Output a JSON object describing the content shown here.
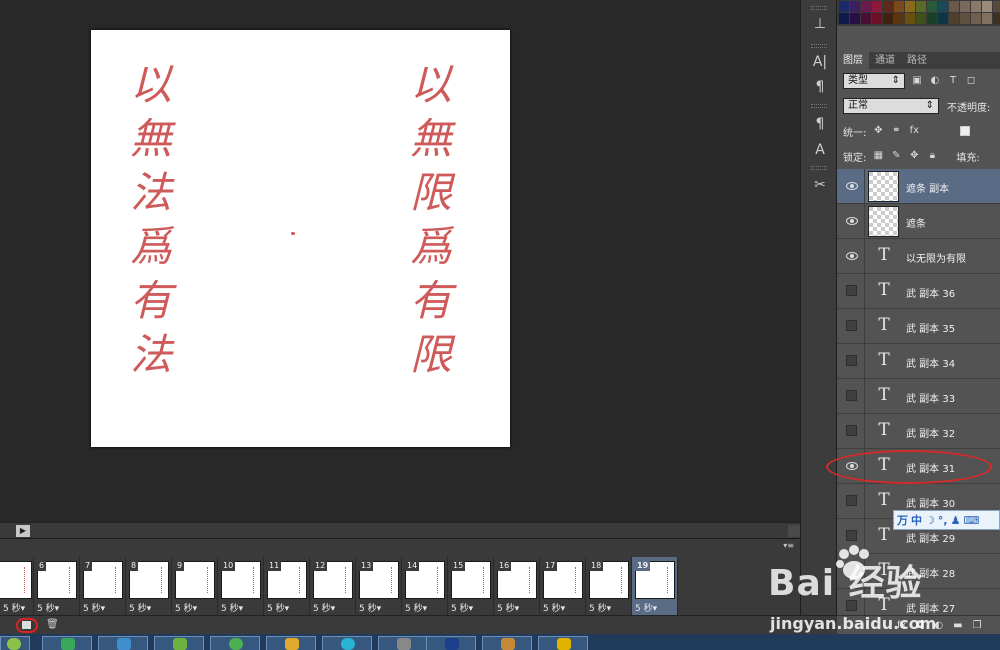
{
  "canvas": {
    "left_column": [
      "以",
      "無",
      "法",
      "爲",
      "有",
      "法"
    ],
    "right_column": [
      "以",
      "無",
      "限",
      "爲",
      "有",
      "限"
    ],
    "ink_color": "#cf5a5a"
  },
  "panels": {
    "tabs": [
      {
        "label": "图层",
        "active": true
      },
      {
        "label": "通道",
        "active": false
      },
      {
        "label": "路径",
        "active": false
      }
    ],
    "filter_kind": "类型",
    "blend_mode": "正常",
    "opacity_label": "不透明度:",
    "unify_label": "统一:",
    "lock_label": "锁定:",
    "fill_label": "填充:"
  },
  "layers": [
    {
      "name": "遮条 副本",
      "type": "image",
      "visible": true,
      "selected": true
    },
    {
      "name": "遮条",
      "type": "image",
      "visible": true,
      "selected": false
    },
    {
      "name": "以无限为有限",
      "type": "text",
      "visible": true,
      "selected": false
    },
    {
      "name": "武 副本 36",
      "type": "text",
      "visible": false,
      "selected": false
    },
    {
      "name": "武 副本 35",
      "type": "text",
      "visible": false,
      "selected": false
    },
    {
      "name": "武 副本 34",
      "type": "text",
      "visible": false,
      "selected": false
    },
    {
      "name": "武 副本 33",
      "type": "text",
      "visible": false,
      "selected": false
    },
    {
      "name": "武 副本 32",
      "type": "text",
      "visible": false,
      "selected": false
    },
    {
      "name": "武 副本 31",
      "type": "text",
      "visible": true,
      "selected": false
    },
    {
      "name": "武 副本 30",
      "type": "text",
      "visible": false,
      "selected": false
    },
    {
      "name": "武 副本 29",
      "type": "text",
      "visible": false,
      "selected": false
    },
    {
      "name": "武 副本 28",
      "type": "text",
      "visible": false,
      "selected": false
    },
    {
      "name": "武 副本 27",
      "type": "text",
      "visible": false,
      "selected": false
    }
  ],
  "timeline": {
    "frames": [
      {
        "number": "",
        "delay": "5 秒▾"
      },
      {
        "number": "6",
        "delay": "5 秒▾"
      },
      {
        "number": "7",
        "delay": "5 秒▾"
      },
      {
        "number": "8",
        "delay": "5 秒▾"
      },
      {
        "number": "9",
        "delay": "5 秒▾"
      },
      {
        "number": "10",
        "delay": "5 秒▾"
      },
      {
        "number": "11",
        "delay": "5 秒▾"
      },
      {
        "number": "12",
        "delay": "5 秒▾"
      },
      {
        "number": "13",
        "delay": "5 秒▾"
      },
      {
        "number": "14",
        "delay": "5 秒▾"
      },
      {
        "number": "15",
        "delay": "5 秒▾"
      },
      {
        "number": "16",
        "delay": "5 秒▾"
      },
      {
        "number": "17",
        "delay": "5 秒▾"
      },
      {
        "number": "18",
        "delay": "5 秒▾"
      },
      {
        "number": "19",
        "delay": "5 秒▾"
      }
    ],
    "selected_frame": "19"
  },
  "ime": {
    "chars": [
      "万",
      "中",
      "☽",
      "°,",
      "♟",
      "⌨"
    ]
  },
  "watermark": {
    "logo": "Bai  经验",
    "url": "jingyan.baidu.com"
  },
  "colors": {
    "selection": "#5a6b86",
    "annotation": "#d62a2a",
    "panel_bg": "#535353"
  }
}
